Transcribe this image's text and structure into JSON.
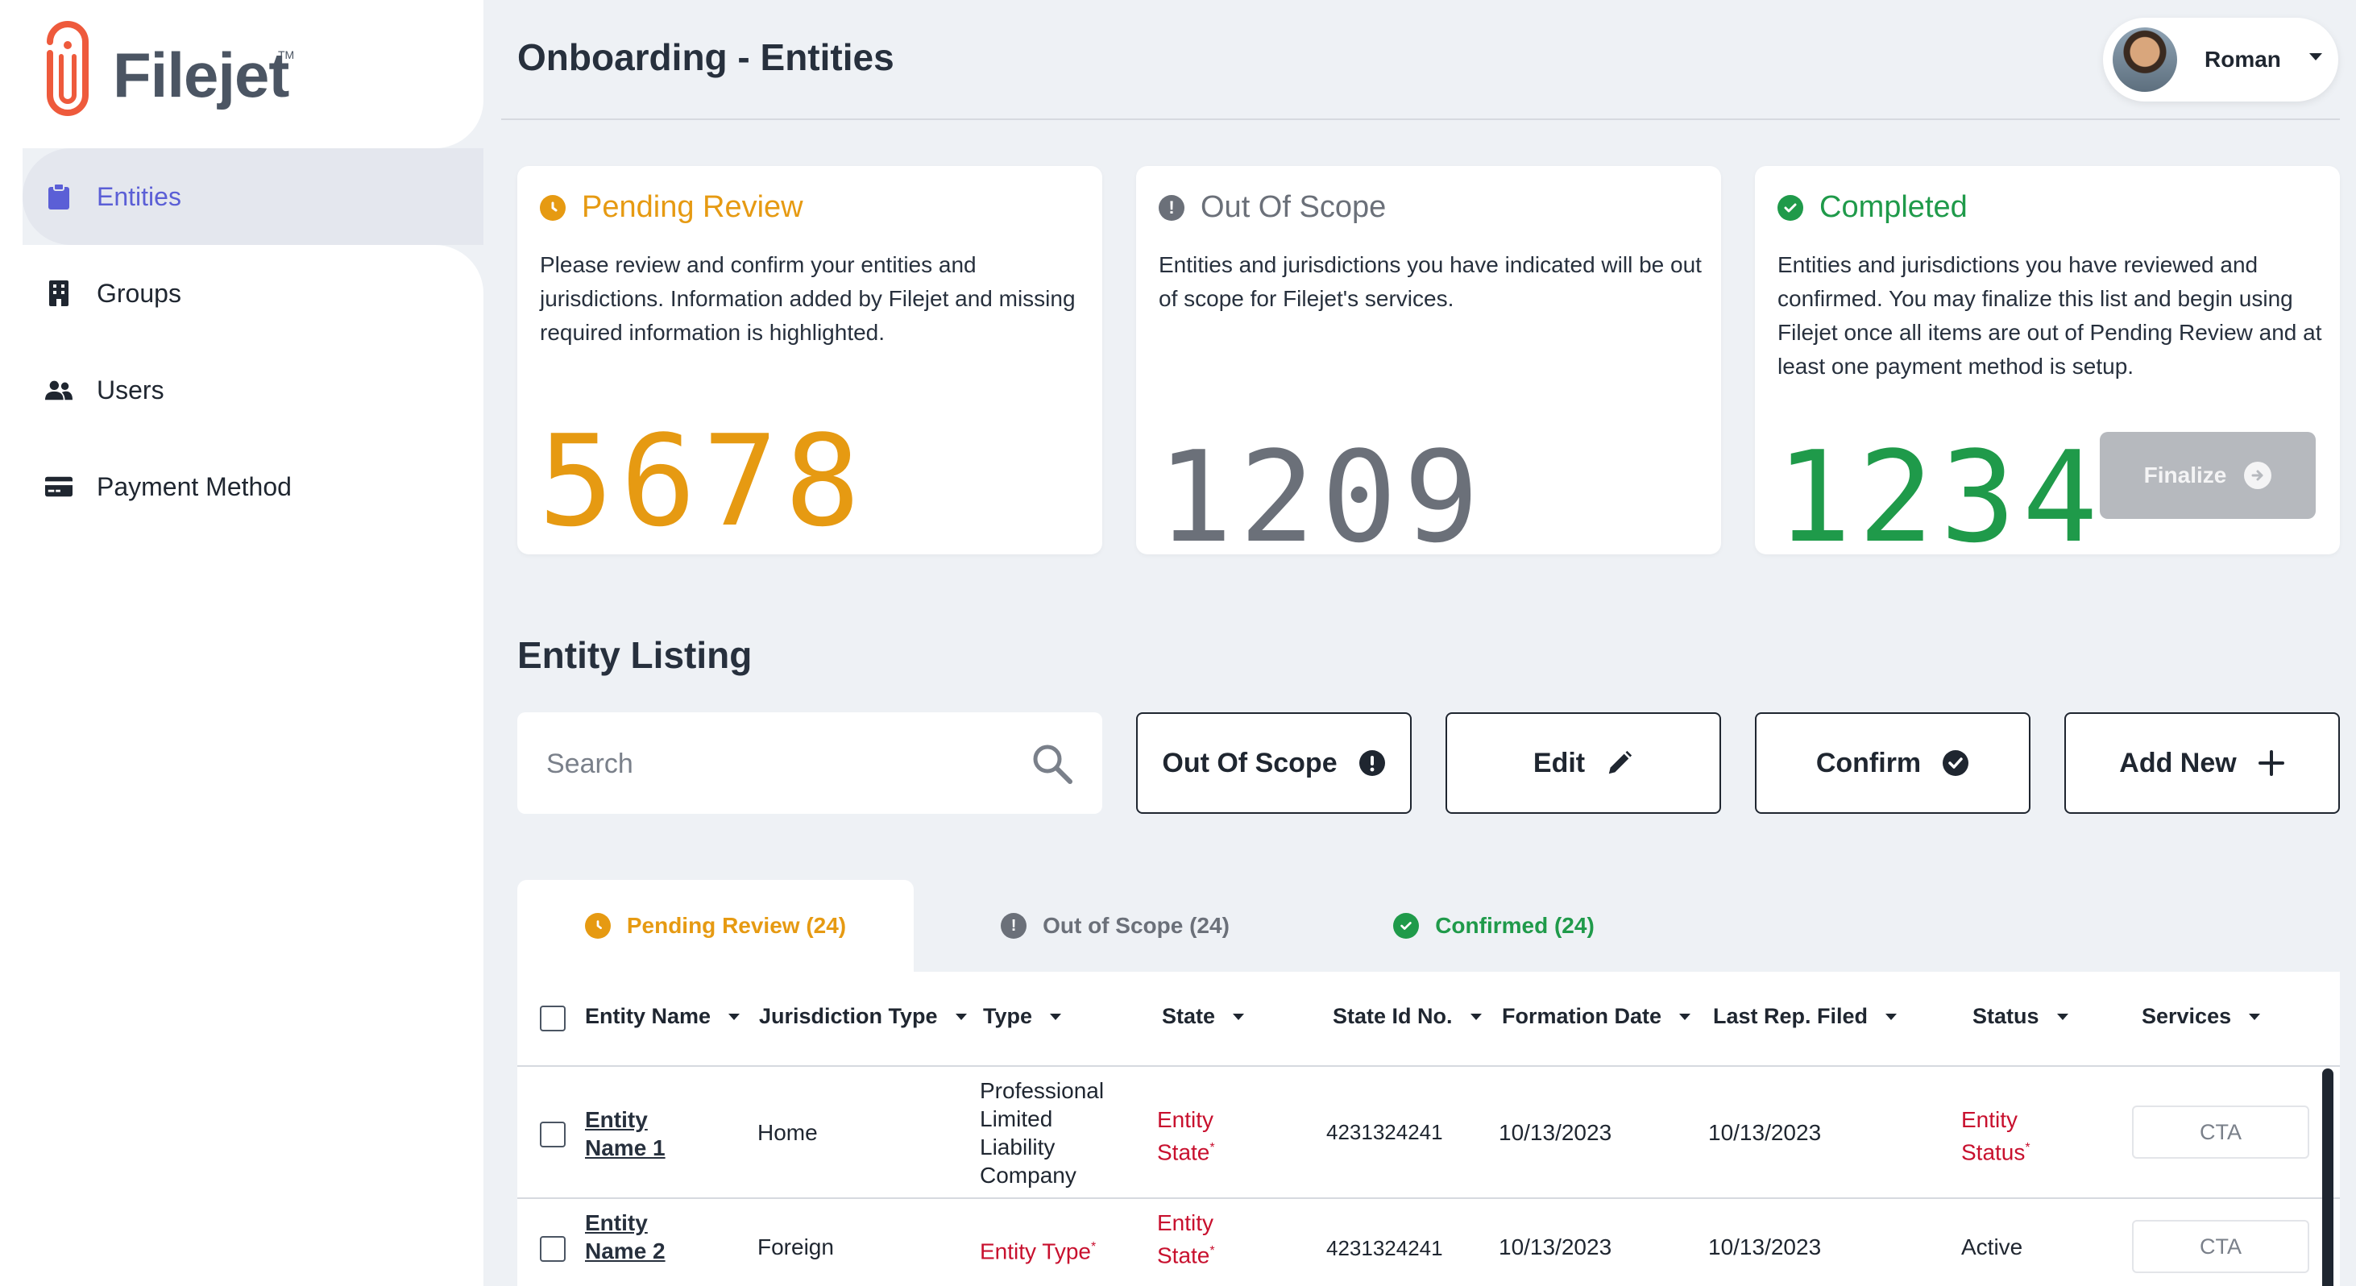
{
  "brand": {
    "name": "Filejet",
    "tm": "TM",
    "accent": "#ee5a3c"
  },
  "sidebar": {
    "items": [
      {
        "label": "Entities",
        "icon": "clipboard-icon",
        "active": true
      },
      {
        "label": "Groups",
        "icon": "building-icon"
      },
      {
        "label": "Users",
        "icon": "users-icon"
      },
      {
        "label": "Payment Method",
        "icon": "credit-card-icon"
      }
    ]
  },
  "header": {
    "title": "Onboarding - Entities",
    "user_name": "Roman"
  },
  "cards": {
    "pending": {
      "title": "Pending Review",
      "description": "Please review and confirm your entities and jurisdictions. Information added by Filejet and missing required information is highlighted.",
      "count": "5678",
      "color": "#e69a12"
    },
    "out_of_scope": {
      "title": "Out Of Scope",
      "description": "Entities and jurisdictions you have indicated will be out of scope for Filejet's services.",
      "count": "1209",
      "color": "#6b7079"
    },
    "completed": {
      "title": "Completed",
      "description": "Entities and jurisdictions you have reviewed and confirmed. You may finalize this list and begin using Filejet once all items are out of Pending Review and at least one payment method is setup.",
      "count": "1234",
      "color": "#1f9a4a",
      "finalize_label": "Finalize"
    }
  },
  "listing": {
    "title": "Entity Listing",
    "search_placeholder": "Search",
    "actions": {
      "out_of_scope": "Out Of Scope",
      "edit": "Edit",
      "confirm": "Confirm",
      "add_new": "Add New"
    },
    "tabs": [
      {
        "label": "Pending Review (24)",
        "active": true
      },
      {
        "label": "Out of Scope (24)"
      },
      {
        "label": "Confirmed (24)"
      }
    ],
    "columns": [
      "Entity Name",
      "Jurisdiction Type",
      "Type",
      "State",
      "State Id No.",
      "Formation Date",
      "Last Rep. Filed",
      "Status",
      "Services"
    ],
    "rows": [
      {
        "entity_name_1": "Entity",
        "entity_name_2": "Name 1",
        "jurisdiction": "Home",
        "type_lines": [
          "Professional",
          "Limited",
          "Liability",
          "Company"
        ],
        "state_1": "Entity",
        "state_2": "State",
        "state_id": "4231324241",
        "formation_date": "10/13/2023",
        "last_rep": "10/13/2023",
        "status_1": "Entity",
        "status_2": "Status",
        "services": "CTA"
      },
      {
        "entity_name_1": "Entity",
        "entity_name_2": "Name 2",
        "jurisdiction": "Foreign",
        "type_warn": "Entity Type",
        "state_1": "Entity",
        "state_2": "State",
        "state_id": "4231324241",
        "formation_date": "10/13/2023",
        "last_rep": "10/13/2023",
        "status": "Active",
        "services": "CTA"
      }
    ]
  }
}
